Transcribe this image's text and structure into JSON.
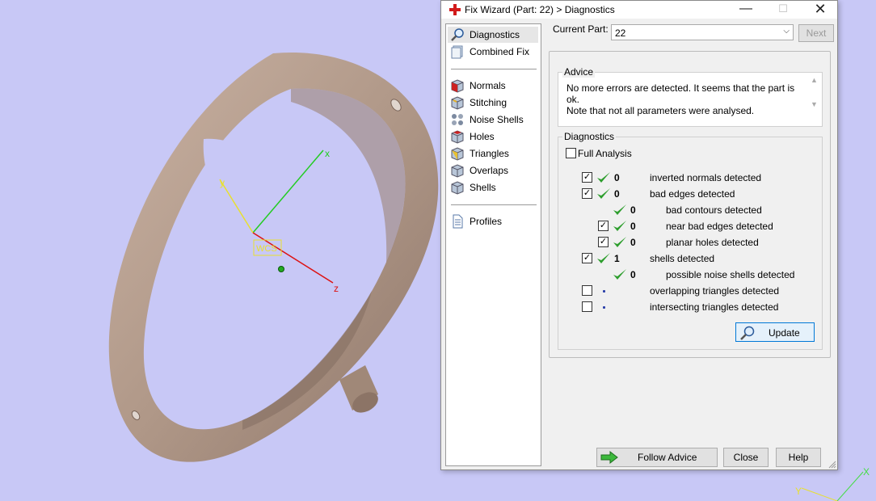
{
  "viewport": {
    "background_color": "#c8c8f6",
    "ring_color": "#b29a8a",
    "wcs_label": "WCS",
    "axis_labels": {
      "x": "x",
      "y": "y",
      "z": "z"
    },
    "corner_axis_labels": {
      "x": "X",
      "y": "Y"
    }
  },
  "dialog": {
    "title": "Fix Wizard (Part: 22) > Diagnostics",
    "window_controls": {
      "minimize": "—",
      "maximize": "☐",
      "close": "✕"
    },
    "nav": {
      "group1": [
        {
          "label": "Diagnostics",
          "icon": "magnifier-icon",
          "selected": true
        },
        {
          "label": "Combined Fix",
          "icon": "combined-fix-icon",
          "selected": false
        }
      ],
      "group2": [
        {
          "label": "Normals",
          "icon": "normals-cube-icon"
        },
        {
          "label": "Stitching",
          "icon": "stitching-cube-icon"
        },
        {
          "label": "Noise Shells",
          "icon": "noise-shells-icon"
        },
        {
          "label": "Holes",
          "icon": "holes-cube-icon"
        },
        {
          "label": "Triangles",
          "icon": "triangles-cube-icon"
        },
        {
          "label": "Overlaps",
          "icon": "overlaps-cube-icon"
        },
        {
          "label": "Shells",
          "icon": "shells-cube-icon"
        }
      ],
      "group3": [
        {
          "label": "Profiles",
          "icon": "profiles-document-icon"
        }
      ]
    },
    "current_part": {
      "label": "Current Part:",
      "value": "22"
    },
    "next_label": "Next",
    "advice": {
      "title": "Advice",
      "line1": "No more errors are detected. It seems that the part is ok.",
      "line2": "Note that not all parameters were analysed."
    },
    "diagnostics": {
      "title": "Diagnostics",
      "full_analysis_label": "Full Analysis",
      "full_analysis_checked": false,
      "rows": [
        {
          "checkbox": true,
          "checked": true,
          "status": "ok",
          "count": "0",
          "label": "inverted normals detected"
        },
        {
          "checkbox": true,
          "checked": true,
          "status": "ok",
          "count": "0",
          "label": "bad edges detected"
        },
        {
          "checkbox": false,
          "checked": false,
          "status": "ok",
          "count": "0",
          "label": "bad contours detected"
        },
        {
          "checkbox": true,
          "checked": true,
          "status": "ok",
          "count": "0",
          "label": "near bad edges detected"
        },
        {
          "checkbox": true,
          "checked": true,
          "status": "ok",
          "count": "0",
          "label": "planar holes detected"
        },
        {
          "checkbox": true,
          "checked": true,
          "status": "ok",
          "count": "1",
          "label": "shells detected"
        },
        {
          "checkbox": false,
          "checked": false,
          "status": "ok",
          "count": "0",
          "label": "possible noise shells detected"
        },
        {
          "checkbox": true,
          "checked": false,
          "status": "pending",
          "count": "",
          "label": "overlapping triangles detected"
        },
        {
          "checkbox": true,
          "checked": false,
          "status": "pending",
          "count": "",
          "label": "intersecting triangles detected"
        }
      ],
      "update_label": "Update"
    },
    "buttons": {
      "follow_advice": "Follow Advice",
      "close": "Close",
      "help": "Help"
    }
  }
}
